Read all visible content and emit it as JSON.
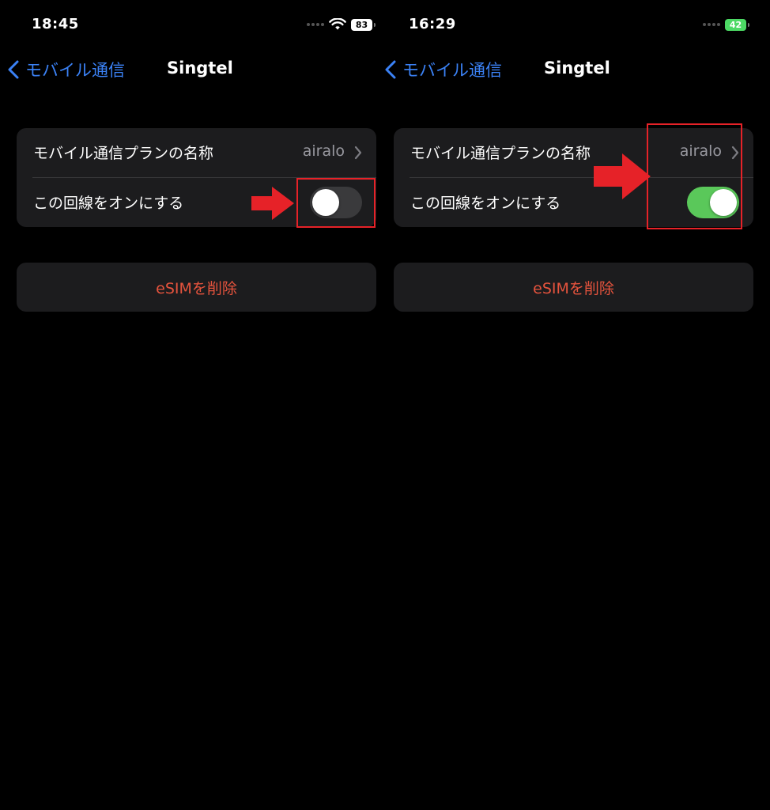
{
  "colors": {
    "accent": "#3b82f6",
    "destructive": "#e5533d",
    "toggle_on": "#5ac85a",
    "toggle_off": "#3a3a3c",
    "annotation": "#e62228"
  },
  "panels": [
    {
      "status_bar": {
        "time": "18:45",
        "battery_level": "83",
        "battery_state": "normal",
        "icons": [
          "signal-dots-icon",
          "wifi-icon",
          "battery-icon"
        ]
      },
      "nav": {
        "back_label": "モバイル通信",
        "title": "Singtel"
      },
      "settings": {
        "plan_name_label": "モバイル通信プランの名称",
        "plan_name_value": "airalo",
        "line_toggle_label": "この回線をオンにする",
        "line_toggle_on": false
      },
      "delete_esim_label": "eSIMを削除"
    },
    {
      "status_bar": {
        "time": "16:29",
        "battery_level": "42",
        "battery_state": "charging",
        "icons": [
          "signal-dots-icon",
          "battery-charging-icon"
        ]
      },
      "nav": {
        "back_label": "モバイル通信",
        "title": "Singtel"
      },
      "settings": {
        "plan_name_label": "モバイル通信プランの名称",
        "plan_name_value": "airalo",
        "line_toggle_label": "この回線をオンにする",
        "line_toggle_on": true
      },
      "delete_esim_label": "eSIMを削除"
    }
  ]
}
